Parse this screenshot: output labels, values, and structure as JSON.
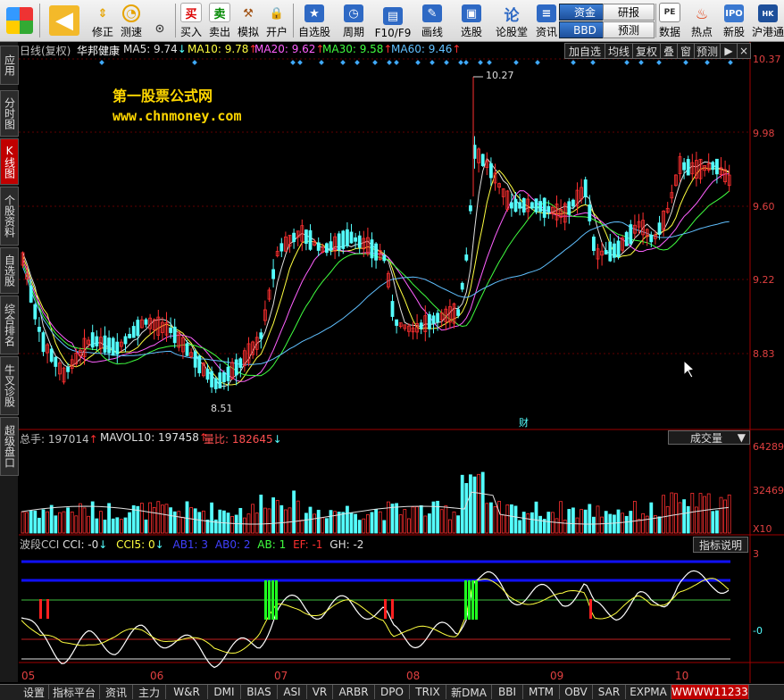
{
  "toolbar": {
    "items": [
      {
        "label": "修正",
        "icon": "up-down-arrow-icon"
      },
      {
        "label": "测速",
        "icon": "clock-icon"
      },
      {
        "label": "买入",
        "icon": "buy-icon",
        "glyph": "买"
      },
      {
        "label": "卖出",
        "icon": "sell-icon",
        "glyph": "卖"
      },
      {
        "label": "模拟",
        "icon": "hammer-icon"
      },
      {
        "label": "开户",
        "icon": "lock-icon"
      },
      {
        "label": "自选股",
        "icon": "star-icon"
      },
      {
        "label": "周期",
        "icon": "period-icon"
      },
      {
        "label": "F10/F9",
        "icon": "f10-icon"
      },
      {
        "label": "画线",
        "icon": "pencil-icon"
      },
      {
        "label": "选股",
        "icon": "screen-icon"
      },
      {
        "label": "论股堂",
        "icon": "discuss-icon"
      },
      {
        "label": "资讯",
        "icon": "news-icon"
      },
      {
        "label": "数据",
        "icon": "pe-icon"
      },
      {
        "label": "热点",
        "icon": "fire-icon"
      },
      {
        "label": "新股",
        "icon": "ipo-icon"
      },
      {
        "label": "沪港通",
        "icon": "hk-icon"
      }
    ],
    "fund_btn": "资金",
    "research_btn": "研报",
    "bbd_btn": "BBD",
    "forecast_btn": "预测"
  },
  "left_tabs": [
    "应用",
    "分时图",
    "K线图",
    "个股资料",
    "自选股",
    "综合排名",
    "牛叉诊股",
    "超级盘口"
  ],
  "main_panel": {
    "period": "日线(复权)",
    "stock_name": "华邦健康",
    "ma": [
      {
        "label": "MA5: 9.74",
        "arrow": "↓",
        "color": "#e0e0e0"
      },
      {
        "label": "MA10: 9.78",
        "arrow": "↑",
        "color": "#ffff40"
      },
      {
        "label": "MA20: 9.62",
        "arrow": "↑",
        "color": "#ff60ff"
      },
      {
        "label": "MA30: 9.58",
        "arrow": "↑",
        "color": "#40ff40"
      },
      {
        "label": "MA60: 9.46",
        "arrow": "↑",
        "color": "#60c0ff"
      }
    ],
    "buttons": [
      "加自选",
      "均线",
      "复权",
      "叠",
      "窗",
      "预测"
    ],
    "watermark_title": "第一股票公式网",
    "watermark_url": "www.chnmoney.com",
    "high_label": "10.27",
    "low_label": "8.51",
    "finance_marker": "财"
  },
  "y_ticks_main": [
    "10.37",
    "9.98",
    "9.60",
    "9.22",
    "8.83"
  ],
  "volume_panel": {
    "total": "总手: 197014",
    "mavol": "MAVOL10: 197458",
    "ratio": "量比: 182645",
    "selector": "成交量",
    "y_ticks": [
      "64289",
      "32469"
    ],
    "unit": "X10"
  },
  "indicator_panel": {
    "name": "波段CCI",
    "cci": "CCI: -0",
    "cci5": "CCI5: 0",
    "ab1": "AB1: 3",
    "ab0": "AB0: 2",
    "ab": "AB: 1",
    "ef": "EF: -1",
    "gh": "GH: -2",
    "help_btn": "指标说明",
    "y_ticks": [
      "3",
      "-0"
    ]
  },
  "x_labels": [
    "05",
    "06",
    "07",
    "08",
    "09",
    "10"
  ],
  "bottom_tabs": [
    "设置",
    "指标平台",
    "资讯",
    "主力",
    "W&R",
    "DMI",
    "BIAS",
    "ASI",
    "VR",
    "ARBR",
    "DPO",
    "TRIX",
    "新DMA",
    "BBI",
    "MTM",
    "OBV",
    "SAR",
    "EXPMA",
    "WWWW11233"
  ],
  "colors": {
    "up": "#ff3030",
    "down": "#54ffff",
    "axis": "#a00000"
  }
}
